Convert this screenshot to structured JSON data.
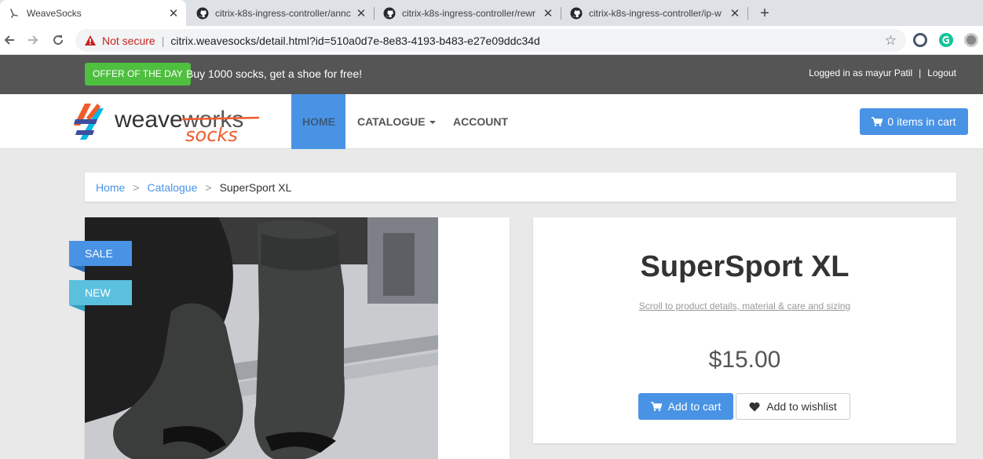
{
  "browser": {
    "tabs": [
      {
        "title": "WeaveSocks",
        "icon": "loading-icon",
        "active": true
      },
      {
        "title": "citrix-k8s-ingress-controller/annc",
        "icon": "github-icon",
        "active": false
      },
      {
        "title": "citrix-k8s-ingress-controller/rewr",
        "icon": "github-icon",
        "active": false
      },
      {
        "title": "citrix-k8s-ingress-controller/ip-w",
        "icon": "github-icon",
        "active": false
      }
    ],
    "security_label": "Not secure",
    "url": "citrix.weavesocks/detail.html?id=510a0d7e-8e83-4193-b483-e27e09ddc34d"
  },
  "topbar": {
    "offer_label": "Offer of the day",
    "offer_text": "Buy 1000 socks, get a shoe for free!",
    "login_text": "Logged in as mayur Patil",
    "separator": "|",
    "logout_label": "Logout"
  },
  "navbar": {
    "logo_word1": "weave",
    "logo_word2": "works",
    "logo_word3": "socks",
    "items": [
      {
        "label": "Home",
        "active": true
      },
      {
        "label": "Catalogue",
        "active": false
      },
      {
        "label": "Account",
        "active": false
      }
    ],
    "cart_label": "0 items in cart"
  },
  "breadcrumb": {
    "items": [
      "Home",
      "Catalogue"
    ],
    "separator": ">",
    "current": "SuperSport XL"
  },
  "product": {
    "ribbons": {
      "sale": "Sale",
      "new": "New"
    },
    "title": "SuperSport XL",
    "scroll_link": "Scroll to product details, material & care and sizing",
    "price": "$15.00",
    "add_to_cart": "Add to cart",
    "add_to_wishlist": "Add to wishlist"
  },
  "colors": {
    "accent": "#4993e4",
    "offer_green": "#4fbf40",
    "topbar_bg": "#555555",
    "new_ribbon": "#5bc0de",
    "logo_orange": "#f15b2a"
  }
}
